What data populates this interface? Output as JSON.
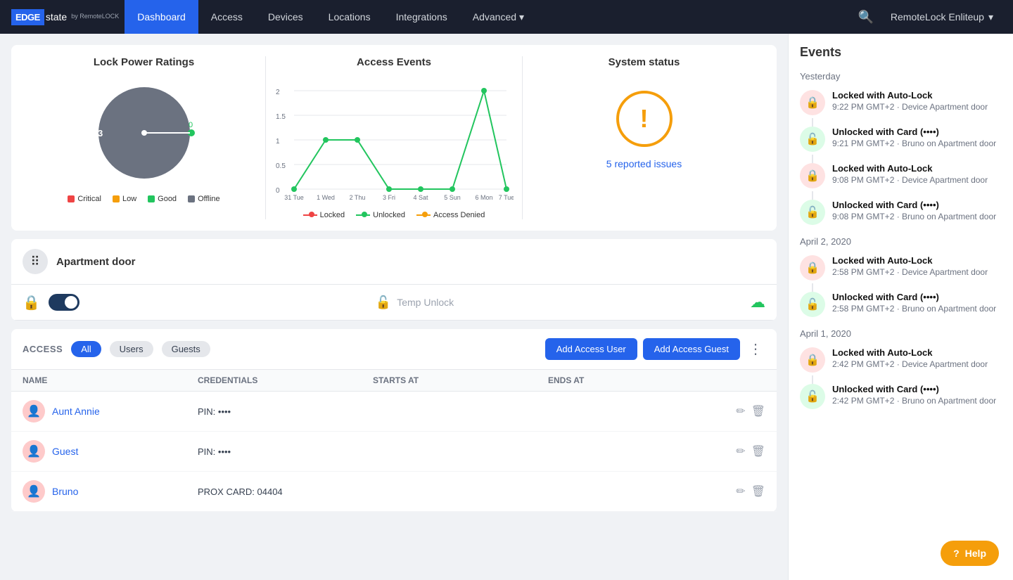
{
  "navbar": {
    "logo_edge": "EDGE",
    "logo_state": "state",
    "logo_sub": "by RemoteLOCK",
    "items": [
      {
        "label": "Dashboard",
        "active": true
      },
      {
        "label": "Access",
        "active": false
      },
      {
        "label": "Devices",
        "active": false
      },
      {
        "label": "Locations",
        "active": false
      },
      {
        "label": "Integrations",
        "active": false
      },
      {
        "label": "Advanced",
        "active": false,
        "arrow": true
      }
    ],
    "account": "RemoteLock Enliteup"
  },
  "lock_power": {
    "title": "Lock Power Ratings",
    "legends": [
      {
        "label": "Critical",
        "color": "#ef4444"
      },
      {
        "label": "Low",
        "color": "#f59e0b"
      },
      {
        "label": "Good",
        "color": "#22c55e"
      },
      {
        "label": "Offline",
        "color": "#6b7280"
      }
    ],
    "needle_value": "0",
    "needle_label": "3"
  },
  "access_events": {
    "title": "Access Events",
    "x_labels": [
      "31 Tue",
      "1 Wed",
      "2 Thu",
      "3 Fri",
      "4 Sat",
      "5 Sun",
      "6 Mon",
      "7 Tue"
    ],
    "y_labels": [
      "0",
      "0.5",
      "1",
      "1.5",
      "2"
    ],
    "legends": [
      {
        "label": "Locked",
        "color": "#ef4444"
      },
      {
        "label": "Unlocked",
        "color": "#22c55e"
      },
      {
        "label": "Access Denied",
        "color": "#f59e0b"
      }
    ]
  },
  "system_status": {
    "title": "System status",
    "issues_text": "5 reported issues"
  },
  "device": {
    "name": "Apartment door",
    "temp_unlock_label": "Temp Unlock"
  },
  "access": {
    "label": "ACCESS",
    "tabs": [
      "All",
      "Users",
      "Guests"
    ],
    "active_tab": "All",
    "add_user_btn": "Add Access User",
    "add_guest_btn": "Add Access Guest",
    "columns": [
      "Name",
      "Credentials",
      "Starts at",
      "Ends at"
    ],
    "rows": [
      {
        "name": "Aunt Annie",
        "credentials": "PIN: ••••",
        "starts_at": "",
        "ends_at": ""
      },
      {
        "name": "Guest",
        "credentials": "PIN: ••••",
        "starts_at": "",
        "ends_at": ""
      },
      {
        "name": "Bruno",
        "credentials": "PROX CARD: 04404",
        "starts_at": "",
        "ends_at": ""
      }
    ]
  },
  "events": {
    "title": "Events",
    "groups": [
      {
        "date": "Yesterday",
        "items": [
          {
            "type": "locked",
            "text": "Locked with Auto-Lock",
            "meta": "9:22 PM GMT+2 · Device Apartment door"
          },
          {
            "type": "unlocked",
            "text": "Unlocked with Card (••••)",
            "meta": "9:21 PM GMT+2 · Bruno on Apartment door"
          },
          {
            "type": "locked",
            "text": "Locked with Auto-Lock",
            "meta": "9:08 PM GMT+2 · Device Apartment door"
          },
          {
            "type": "unlocked",
            "text": "Unlocked with Card (••••)",
            "meta": "9:08 PM GMT+2 · Bruno on Apartment door"
          }
        ]
      },
      {
        "date": "April 2, 2020",
        "items": [
          {
            "type": "locked",
            "text": "Locked with Auto-Lock",
            "meta": "2:58 PM GMT+2 · Device Apartment door"
          },
          {
            "type": "unlocked",
            "text": "Unlocked with Card (••••)",
            "meta": "2:58 PM GMT+2 · Bruno on Apartment door"
          }
        ]
      },
      {
        "date": "April 1, 2020",
        "items": [
          {
            "type": "locked",
            "text": "Locked with Auto-Lock",
            "meta": "2:42 PM GMT+2 · Device Apartment door"
          },
          {
            "type": "unlocked",
            "text": "Unlocked with Card (••••)",
            "meta": "2:42 PM GMT+2 · Bruno on Apartment door"
          }
        ]
      }
    ]
  },
  "help_btn": "Help"
}
